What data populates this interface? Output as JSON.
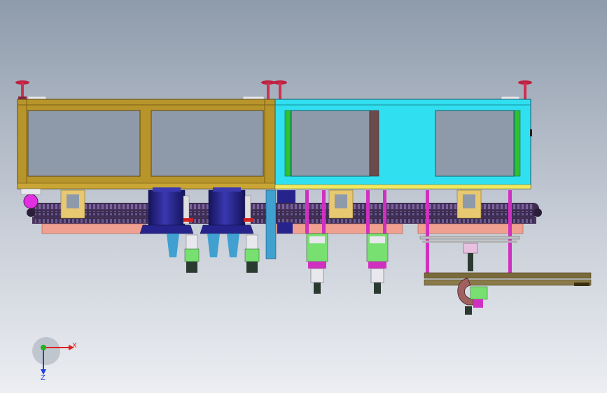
{
  "triad": {
    "x_label": "X",
    "z_label": "Z",
    "x_color": "#e02020",
    "y_color": "#20b020",
    "z_color": "#2040e0"
  },
  "colors": {
    "frame_left": "#b8952a",
    "frame_right": "#30dff0",
    "conveyor": "#4a3560",
    "chain_links": "#7a62a0",
    "base_plate": "#f0a090",
    "cylinders": "#26248c",
    "rods": "#d030c0",
    "sensor": "#78e070",
    "guide": "#7a6a3a"
  }
}
